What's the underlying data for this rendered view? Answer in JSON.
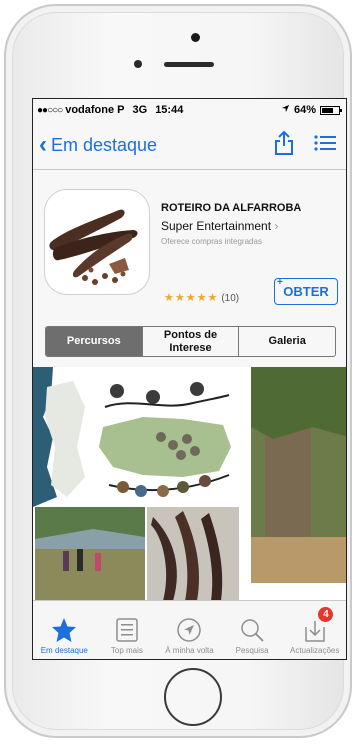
{
  "status_bar": {
    "signal": "●●○○○",
    "carrier": "vodafone P",
    "network": "3G",
    "time": "15:44",
    "battery": "64%"
  },
  "nav": {
    "back_label": "Em destaque"
  },
  "app": {
    "name": "ROTEIRO DA ALFARROBA",
    "developer": "Super Entertainment",
    "in_app": "Oferece compras integradas",
    "rating_stars": "★★★★★",
    "rating_count": "(10)",
    "get_label": "OBTER",
    "get_plus": "+"
  },
  "segments": [
    "Percursos",
    "Pontos de Interese",
    "Galeria"
  ],
  "tabs": [
    {
      "label": "Em destaque",
      "icon": "star-icon",
      "active": true
    },
    {
      "label": "Top mais",
      "icon": "list-icon",
      "active": false
    },
    {
      "label": "À minha volta",
      "icon": "location-icon",
      "active": false
    },
    {
      "label": "Pesquisa",
      "icon": "search-icon",
      "active": false
    },
    {
      "label": "Actualizações",
      "icon": "updates-icon",
      "active": false,
      "badge": "4"
    }
  ],
  "colors": {
    "accent": "#1e6fd9",
    "badge": "#e8342b",
    "star": "#f5a623"
  }
}
